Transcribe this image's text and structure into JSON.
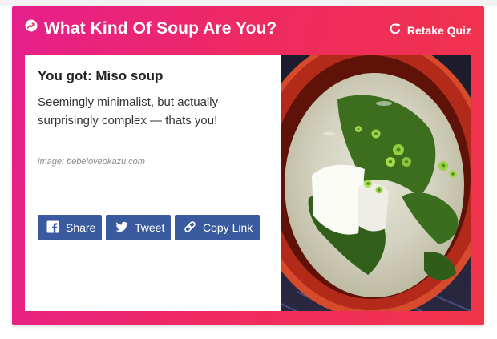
{
  "quiz": {
    "title": "What Kind Of Soup Are You?",
    "retake_label": "Retake Quiz",
    "trending_icon": "trending-icon",
    "retake_icon": "refresh-icon"
  },
  "result": {
    "title": "You got: Miso soup",
    "description": "Seemingly minimalist, but actually surprisingly complex — thats you!",
    "image_credit": "image: bebeloveokazu.com",
    "image_subject": "miso-soup-photo"
  },
  "share": {
    "facebook_label": "Share",
    "twitter_label": "Tweet",
    "copy_label": "Copy Link",
    "facebook_icon": "facebook-icon",
    "twitter_icon": "twitter-icon",
    "link_icon": "link-icon"
  },
  "colors": {
    "accent_start": "#e61f8c",
    "accent_end": "#f0344a",
    "button": "#3a5aa0"
  }
}
